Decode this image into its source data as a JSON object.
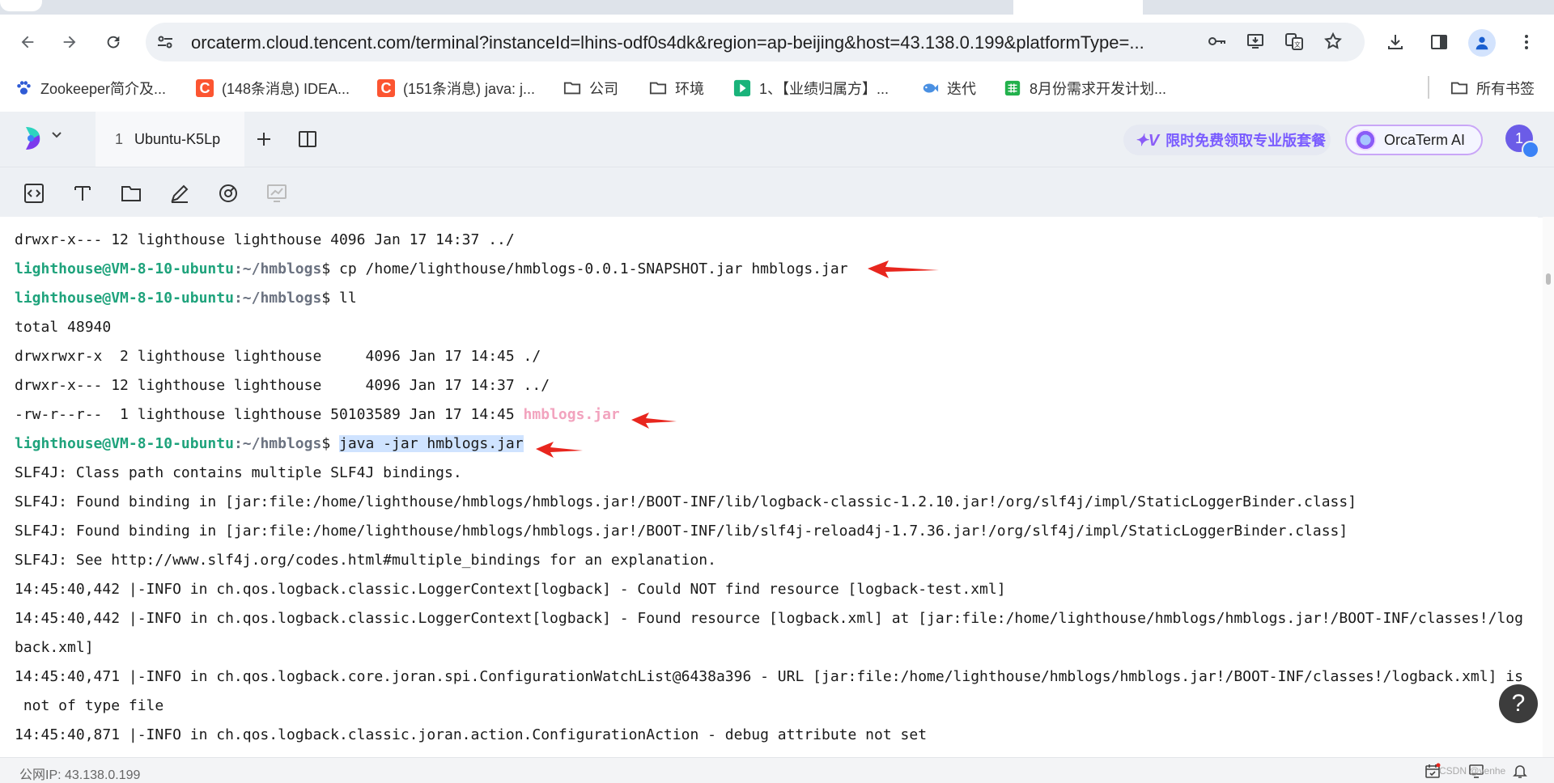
{
  "browser": {
    "url": "orcaterm.cloud.tencent.com/terminal?instanceId=lhins-odf0s4dk&region=ap-beijing&host=43.138.0.199&platformType=...",
    "bookmarks": [
      {
        "label": "Zookeeper简介及...",
        "icon_color": "#2f5bd5",
        "icon": "paw-icon"
      },
      {
        "label": "(148条消息) IDEA...",
        "icon_color": "#fc5531",
        "icon": "csdn-icon"
      },
      {
        "label": "(151条消息) java: j...",
        "icon_color": "#fc5531",
        "icon": "csdn-icon"
      },
      {
        "label": "公司",
        "icon_color": "#555555",
        "icon": "folder-icon"
      },
      {
        "label": "环境",
        "icon_color": "#555555",
        "icon": "folder-icon"
      },
      {
        "label": "1、【业绩归属方】...",
        "icon_color": "#19b37a",
        "icon": "play-icon"
      },
      {
        "label": "迭代",
        "icon_color": "#4a90e2",
        "icon": "fish-icon"
      },
      {
        "label": "8月份需求开发计划...",
        "icon_color": "#22b14c",
        "icon": "sheet-icon"
      }
    ],
    "all_bookmarks": "所有书签"
  },
  "orca": {
    "session_number": "1",
    "session_name": "Ubuntu-K5Lp",
    "promo": "限时免费领取专业版套餐",
    "ai_label": "OrcaTerm AI",
    "user_badge": "1"
  },
  "terminal": {
    "prompt_user": "lighthouse@VM-8-10-ubuntu",
    "prompt_path": ":~/hmblogs",
    "lines": [
      {
        "type": "text",
        "text": "drwxr-x--- 12 lighthouse lighthouse 4096 Jan 17 14:37 ../"
      },
      {
        "type": "prompt",
        "cmd": "$ cp /home/lighthouse/hmblogs-0.0.1-SNAPSHOT.jar hmblogs.jar"
      },
      {
        "type": "prompt",
        "cmd": "$ ll"
      },
      {
        "type": "text",
        "text": "total 48940"
      },
      {
        "type": "text",
        "text": "drwxrwxr-x  2 lighthouse lighthouse     4096 Jan 17 14:45 ./"
      },
      {
        "type": "text",
        "text": "drwxr-x--- 12 lighthouse lighthouse     4096 Jan 17 14:37 ../"
      },
      {
        "type": "file",
        "text": "-rw-r--r--  1 lighthouse lighthouse 50103589 Jan 17 14:45 ",
        "file": "hmblogs.jar"
      },
      {
        "type": "prompt_sel",
        "pre": "$ ",
        "cmd": "java -jar hmblogs.jar"
      },
      {
        "type": "text",
        "text": "SLF4J: Class path contains multiple SLF4J bindings."
      },
      {
        "type": "text",
        "text": "SLF4J: Found binding in [jar:file:/home/lighthouse/hmblogs/hmblogs.jar!/BOOT-INF/lib/logback-classic-1.2.10.jar!/org/slf4j/impl/StaticLoggerBinder.class]"
      },
      {
        "type": "text",
        "text": "SLF4J: Found binding in [jar:file:/home/lighthouse/hmblogs/hmblogs.jar!/BOOT-INF/lib/slf4j-reload4j-1.7.36.jar!/org/slf4j/impl/StaticLoggerBinder.class]"
      },
      {
        "type": "text",
        "text": "SLF4J: See http://www.slf4j.org/codes.html#multiple_bindings for an explanation."
      },
      {
        "type": "text",
        "text": "14:45:40,442 |-INFO in ch.qos.logback.classic.LoggerContext[logback] - Could NOT find resource [logback-test.xml]"
      },
      {
        "type": "text",
        "text": "14:45:40,442 |-INFO in ch.qos.logback.classic.LoggerContext[logback] - Found resource [logback.xml] at [jar:file:/home/lighthouse/hmblogs/hmblogs.jar!/BOOT-INF/classes!/log"
      },
      {
        "type": "text",
        "text": "back.xml]"
      },
      {
        "type": "text",
        "text": "14:45:40,471 |-INFO in ch.qos.logback.core.joran.spi.ConfigurationWatchList@6438a396 - URL [jar:file:/home/lighthouse/hmblogs/hmblogs.jar!/BOOT-INF/classes!/logback.xml] is"
      },
      {
        "type": "text",
        "text": " not of type file"
      },
      {
        "type": "text",
        "text": "14:45:40,871 |-INFO in ch.qos.logback.classic.joran.action.ConfigurationAction - debug attribute not set"
      }
    ]
  },
  "status": {
    "ip": "公网IP: 43.138.0.199",
    "watermark": "CSDN @venhe"
  },
  "colors": {
    "prompt_user": "#1fa37c",
    "jar_highlight": "#f2a3be",
    "selection": "#cfe3ff",
    "arrow": "#e8261e"
  }
}
